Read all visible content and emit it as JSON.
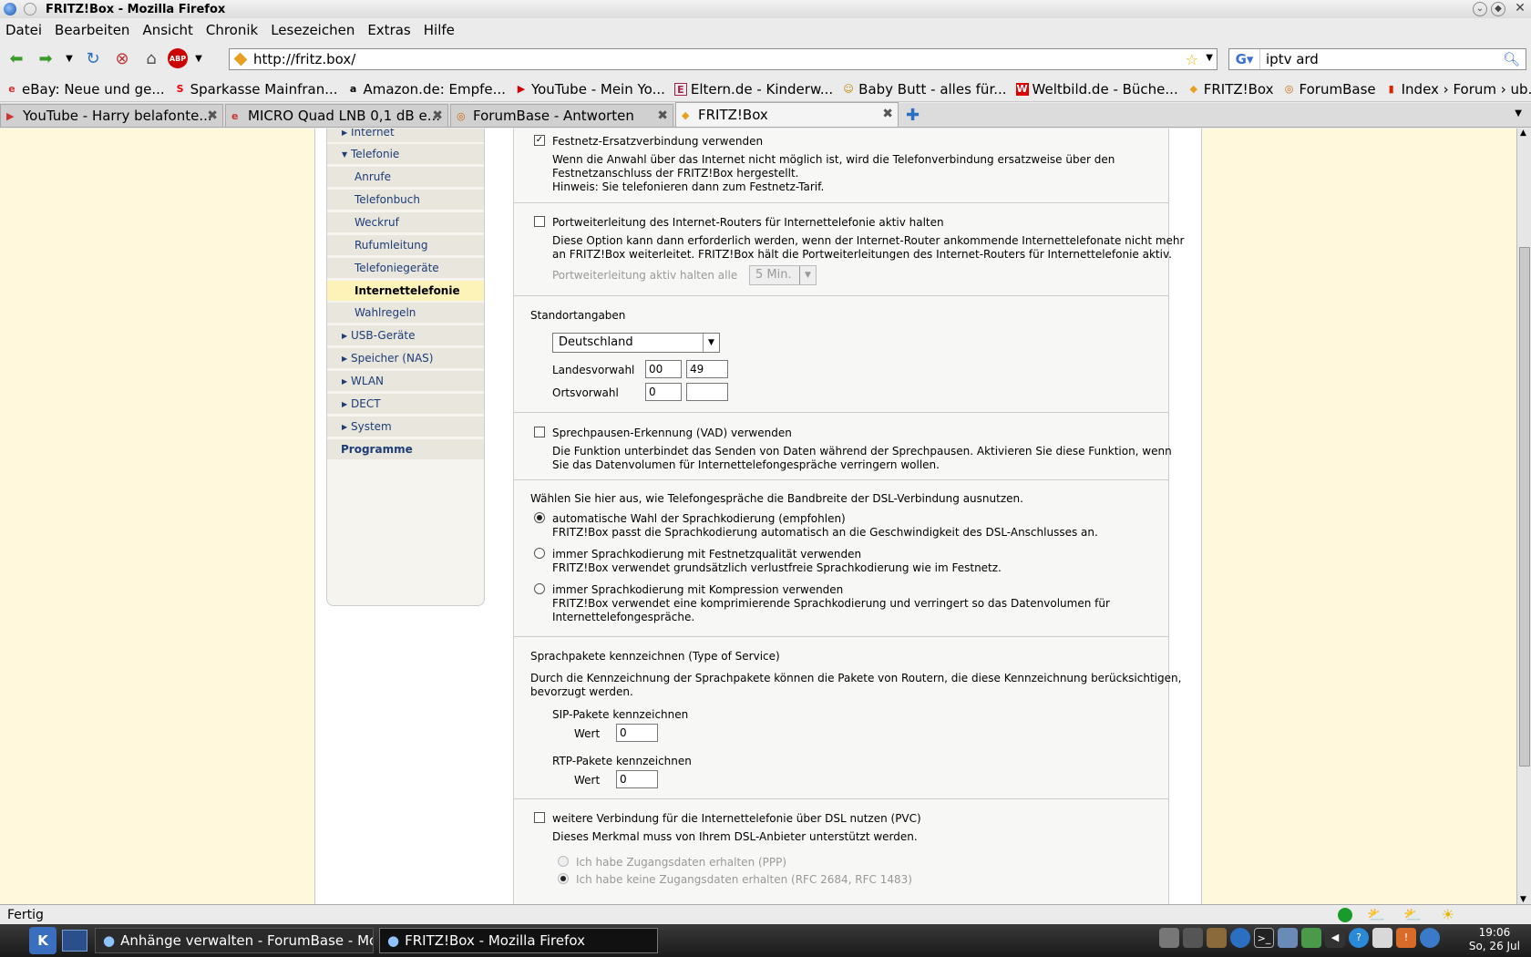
{
  "window": {
    "title": "FRITZ!Box - Mozilla Firefox"
  },
  "menu": [
    "Datei",
    "Bearbeiten",
    "Ansicht",
    "Chronik",
    "Lesezeichen",
    "Extras",
    "Hilfe"
  ],
  "url": "http://fritz.box/",
  "search": "iptv ard",
  "bookmarks": [
    "eBay: Neue und ge...",
    "Sparkasse Mainfran...",
    "Amazon.de: Empfe...",
    "YouTube - Mein Yo...",
    "Eltern.de - Kinderw...",
    "Baby Butt - alles für...",
    "Weltbild.de - Büche...",
    "FRITZ!Box",
    "ForumBase",
    "Index › Forum › ub..."
  ],
  "tabs": [
    "YouTube - Harry belafonte...",
    "MICRO Quad LNB 0,1 dB e...",
    "ForumBase - Antworten",
    "FRITZ!Box"
  ],
  "nav": {
    "internet": "Internet",
    "telefonie": "Telefonie",
    "anrufe": "Anrufe",
    "telefonbuch": "Telefonbuch",
    "weckruf": "Weckruf",
    "rufumleitung": "Rufumleitung",
    "telefoniegeraete": "Telefoniegeräte",
    "internettelefonie": "Internettelefonie",
    "wahlregeln": "Wahlregeln",
    "usb": "USB-Geräte",
    "speicher": "Speicher (NAS)",
    "wlan": "WLAN",
    "dect": "DECT",
    "system": "System",
    "programme": "Programme"
  },
  "festnetz": {
    "label": "Festnetz-Ersatzverbindung verwenden",
    "checked": true,
    "line1": "Wenn die Anwahl über das Internet nicht möglich ist, wird die Telefonverbindung ersatzweise über den",
    "line2": "Festnetzanschluss der FRITZ!Box hergestellt.",
    "line3": "Hinweis: Sie telefonieren dann zum Festnetz-Tarif."
  },
  "portweiterleitung": {
    "label": "Portweiterleitung des Internet-Routers für Internettelefonie aktiv halten",
    "line1": "Diese Option kann dann erforderlich werden, wenn der Internet-Router ankommende Internettelefonate nicht mehr",
    "line2": "an FRITZ!Box weiterleitet. FRITZ!Box hält die Portweiterleitungen des Internet-Routers für Internettelefonie aktiv.",
    "interval_label": "Portweiterleitung aktiv halten alle",
    "interval_value": "5 Min."
  },
  "standort": {
    "heading": "Standortangaben",
    "country": "Deutschland",
    "landes_label": "Landesvorwahl",
    "landes_prefix": "00",
    "landes_value": "49",
    "orts_label": "Ortsvorwahl",
    "orts_prefix": "0",
    "orts_value": ""
  },
  "vad": {
    "label": "Sprechpausen-Erkennung (VAD) verwenden",
    "line1": "Die Funktion unterbindet das Senden von Daten während der Sprechpausen. Aktivieren Sie diese Funktion, wenn",
    "line2": "Sie das Datenvolumen für Internettelefongespräche verringern wollen."
  },
  "bandbreite": {
    "heading": "Wählen Sie hier aus, wie Telefongespräche die Bandbreite der DSL-Verbindung ausnutzen.",
    "opt1": "automatische Wahl der Sprachkodierung (empfohlen)",
    "opt1_desc": "FRITZ!Box passt die Sprachkodierung automatisch an die Geschwindigkeit des DSL-Anschlusses an.",
    "opt2": "immer Sprachkodierung mit Festnetzqualität verwenden",
    "opt2_desc": "FRITZ!Box verwendet grundsätzlich verlustfreie Sprachkodierung wie im Festnetz.",
    "opt3": "immer Sprachkodierung mit Kompression verwenden",
    "opt3_desc1": "FRITZ!Box verwendet eine komprimierende Sprachkodierung und verringert so das Datenvolumen für",
    "opt3_desc2": "Internettelefongespräche.",
    "selected": 1
  },
  "tos": {
    "heading": "Sprachpakete kennzeichnen (Type of Service)",
    "line1": "Durch die Kennzeichnung der Sprachpakete können die Pakete von Routern, die diese Kennzeichnung berücksichtigen,",
    "line2": "bevorzugt werden.",
    "sip_label": "SIP-Pakete kennzeichnen",
    "rtp_label": "RTP-Pakete kennzeichnen",
    "wert": "Wert",
    "sip_value": "0",
    "rtp_value": "0"
  },
  "pvc": {
    "label": "weitere Verbindung für die Internettelefonie über DSL nutzen (PVC)",
    "line1": "Dieses Merkmal muss von Ihrem DSL-Anbieter unterstützt werden.",
    "opt1": "Ich habe Zugangsdaten erhalten (PPP)",
    "opt2": "Ich habe keine Zugangsdaten erhalten (RFC 2684, RFC 1483)"
  },
  "status": "Fertig",
  "taskbar": {
    "btn1": "Anhänge verwalten - ForumBase - Mozil",
    "btn2": "FRITZ!Box - Mozilla Firefox",
    "time": "19:06",
    "date": "So, 26 Jul"
  }
}
